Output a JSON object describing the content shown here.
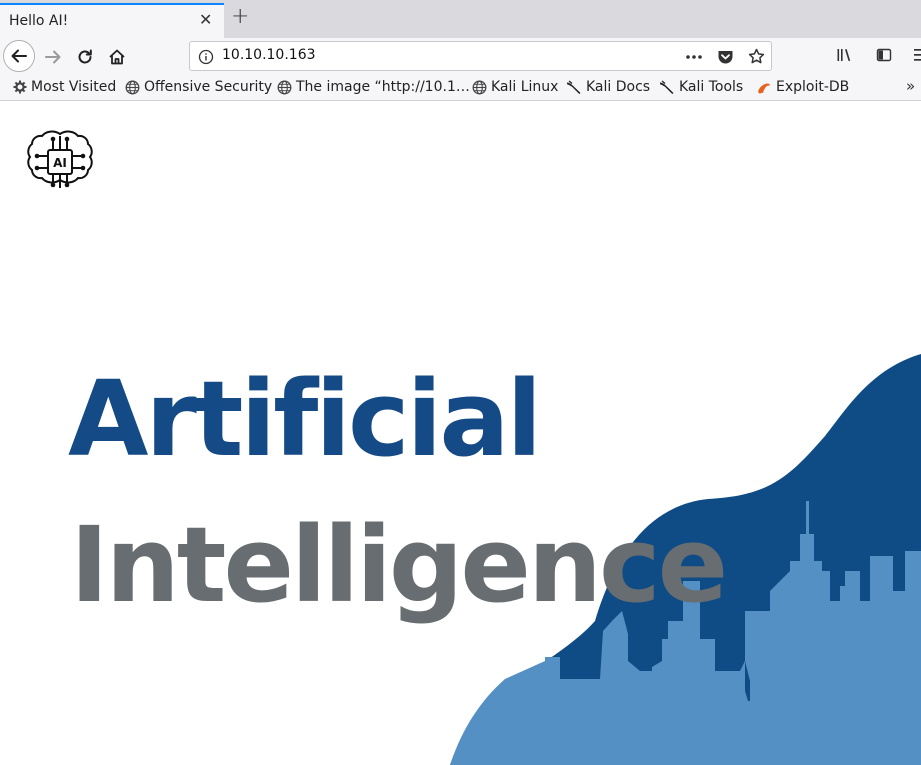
{
  "browser": {
    "tab": {
      "title": "Hello AI!"
    },
    "url": "10.10.10.163",
    "bookmarks": [
      {
        "label": "Most Visited",
        "icon": "gear-icon"
      },
      {
        "label": "Offensive Security",
        "icon": "globe-icon"
      },
      {
        "label": "The image “http://10.1…",
        "icon": "globe-icon"
      },
      {
        "label": "Kali Linux",
        "icon": "globe-icon"
      },
      {
        "label": "Kali Docs",
        "icon": "kali-dragon-icon"
      },
      {
        "label": "Kali Tools",
        "icon": "kali-dragon-icon"
      },
      {
        "label": "Exploit-DB",
        "icon": "exploit-db-icon"
      }
    ]
  },
  "page": {
    "logo_text": "AI",
    "headline_line1": "Artificial",
    "headline_line2": "Intelligence"
  },
  "colors": {
    "tab_accent": "#0a84ff",
    "headline_blue": "#144a86",
    "headline_gray": "#676d70",
    "wave_dark": "#0f4c85",
    "skyline_light": "#5590c4"
  }
}
